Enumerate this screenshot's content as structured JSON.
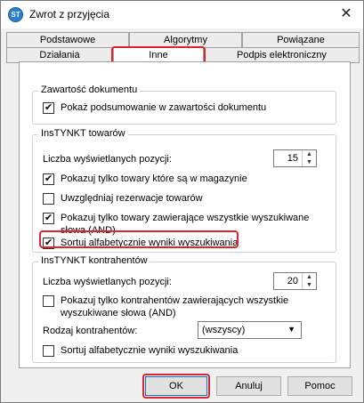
{
  "window": {
    "title": "Zwrot z przyjęcia",
    "close_glyph": "✕",
    "icon_text": "ST"
  },
  "tabs_row1": [
    {
      "label": "Podstawowe"
    },
    {
      "label": "Algorytmy"
    },
    {
      "label": "Powiązane"
    }
  ],
  "tabs_row2": [
    {
      "label": "Działania"
    },
    {
      "label": "Inne"
    },
    {
      "label": "Podpis elektroniczny"
    }
  ],
  "doc_group": {
    "title": "Zawartość dokumentu",
    "show_summary": {
      "label": "Pokaż podsumowanie w zawartości dokumentu",
      "checked": true
    }
  },
  "products_group": {
    "title": "InsTYNKT towarów",
    "count_label": "Liczba wyświetlanych pozycji:",
    "count_value": "15",
    "only_in_stock": {
      "label": "Pokazuj tylko towary które są w magazynie",
      "checked": true
    },
    "reservations": {
      "label": "Uwzględniaj rezerwacje towarów",
      "checked": false
    },
    "all_words": {
      "label": "Pokazuj tylko towary zawierające wszystkie wyszukiwane słowa (AND)",
      "checked": true
    },
    "sort_alpha": {
      "label": "Sortuj alfabetycznie wyniki wyszukiwania",
      "checked": true
    }
  },
  "contractors_group": {
    "title": "InsTYNKT kontrahentów",
    "count_label": "Liczba wyświetlanych pozycji:",
    "count_value": "20",
    "all_words": {
      "label": "Pokazuj tylko kontrahentów zawierających wszystkie wyszukiwane słowa (AND)",
      "checked": false
    },
    "type_label": "Rodzaj kontrahentów:",
    "type_value": "(wszyscy)",
    "sort_alpha": {
      "label": "Sortuj alfabetycznie wyniki wyszukiwania",
      "checked": false
    }
  },
  "buttons": {
    "ok": "OK",
    "cancel": "Anuluj",
    "help": "Pomoc"
  },
  "colors": {
    "highlight": "#e0242a",
    "accent": "#0078d7"
  }
}
